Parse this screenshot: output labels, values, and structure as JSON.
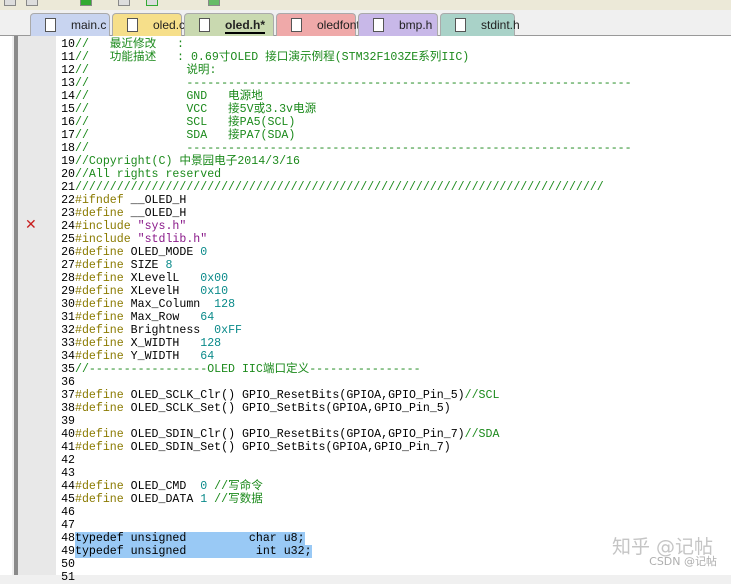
{
  "tabs": [
    {
      "label": "main.c",
      "color": "#c8d4f0",
      "active": false
    },
    {
      "label": "oled.c",
      "color": "#f6df8a",
      "active": false
    },
    {
      "label": "oled.h*",
      "color": "#c9d9b0",
      "active": true
    },
    {
      "label": "oledfont.h",
      "color": "#efa9a9",
      "active": false
    },
    {
      "label": "bmp.h",
      "color": "#c8b8e8",
      "active": false
    },
    {
      "label": "stdint.h",
      "color": "#a9d2c8",
      "active": false
    }
  ],
  "editor": {
    "error_line": 24,
    "selected_lines": [
      48,
      49
    ],
    "lines": [
      {
        "n": "10",
        "t": [
          [
            "c",
            "//   最近修改   :"
          ]
        ]
      },
      {
        "n": "11",
        "t": [
          [
            "c",
            "//   功能描述   : 0.69寸OLED 接口演示例程(STM32F103ZE系列IIC)"
          ]
        ]
      },
      {
        "n": "12",
        "t": [
          [
            "c",
            "//              说明:"
          ]
        ]
      },
      {
        "n": "13",
        "t": [
          [
            "c",
            "//              ----------------------------------------------------------------"
          ]
        ]
      },
      {
        "n": "14",
        "t": [
          [
            "c",
            "//              GND   电源地"
          ]
        ]
      },
      {
        "n": "15",
        "t": [
          [
            "c",
            "//              VCC   接5V或3.3v电源"
          ]
        ]
      },
      {
        "n": "16",
        "t": [
          [
            "c",
            "//              SCL   接PA5(SCL)"
          ]
        ]
      },
      {
        "n": "17",
        "t": [
          [
            "c",
            "//              SDA   接PA7(SDA)"
          ]
        ]
      },
      {
        "n": "18",
        "t": [
          [
            "c",
            "//              ----------------------------------------------------------------"
          ]
        ]
      },
      {
        "n": "19",
        "t": [
          [
            "c",
            "//Copyright(C) 中景园电子2014/3/16"
          ]
        ]
      },
      {
        "n": "20",
        "t": [
          [
            "c",
            "//All rights reserved"
          ]
        ]
      },
      {
        "n": "21",
        "t": [
          [
            "c",
            "////////////////////////////////////////////////////////////////////////////"
          ]
        ]
      },
      {
        "n": "22",
        "t": [
          [
            "p",
            "#ifndef "
          ],
          [
            "t",
            "__OLED_H"
          ]
        ]
      },
      {
        "n": "23",
        "t": [
          [
            "p",
            "#define "
          ],
          [
            "t",
            "__OLED_H"
          ]
        ]
      },
      {
        "n": "24",
        "t": [
          [
            "p",
            "#include "
          ],
          [
            "s",
            "\"sys.h\""
          ]
        ]
      },
      {
        "n": "25",
        "t": [
          [
            "p",
            "#include "
          ],
          [
            "s",
            "\"stdlib.h\""
          ]
        ]
      },
      {
        "n": "26",
        "t": [
          [
            "p",
            "#define "
          ],
          [
            "t",
            "OLED_MODE "
          ],
          [
            "n",
            "0"
          ]
        ]
      },
      {
        "n": "27",
        "t": [
          [
            "p",
            "#define "
          ],
          [
            "t",
            "SIZE "
          ],
          [
            "n",
            "8"
          ]
        ]
      },
      {
        "n": "28",
        "t": [
          [
            "p",
            "#define "
          ],
          [
            "t",
            "XLevelL   "
          ],
          [
            "n",
            "0x00"
          ]
        ]
      },
      {
        "n": "29",
        "t": [
          [
            "p",
            "#define "
          ],
          [
            "t",
            "XLevelH   "
          ],
          [
            "n",
            "0x10"
          ]
        ]
      },
      {
        "n": "30",
        "t": [
          [
            "p",
            "#define "
          ],
          [
            "t",
            "Max_Column  "
          ],
          [
            "n",
            "128"
          ]
        ]
      },
      {
        "n": "31",
        "t": [
          [
            "p",
            "#define "
          ],
          [
            "t",
            "Max_Row   "
          ],
          [
            "n",
            "64"
          ]
        ]
      },
      {
        "n": "32",
        "t": [
          [
            "p",
            "#define "
          ],
          [
            "t",
            "Brightness  "
          ],
          [
            "n",
            "0xFF"
          ]
        ]
      },
      {
        "n": "33",
        "t": [
          [
            "p",
            "#define "
          ],
          [
            "t",
            "X_WIDTH   "
          ],
          [
            "n",
            "128"
          ]
        ]
      },
      {
        "n": "34",
        "t": [
          [
            "p",
            "#define "
          ],
          [
            "t",
            "Y_WIDTH   "
          ],
          [
            "n",
            "64"
          ]
        ]
      },
      {
        "n": "35",
        "t": [
          [
            "c",
            "//-----------------OLED IIC端口定义----------------"
          ]
        ]
      },
      {
        "n": "36",
        "t": []
      },
      {
        "n": "37",
        "t": [
          [
            "p",
            "#define "
          ],
          [
            "t",
            "OLED_SCLK_Clr() GPIO_ResetBits(GPIOA,GPIO_Pin_5)"
          ],
          [
            "c",
            "//SCL"
          ]
        ]
      },
      {
        "n": "38",
        "t": [
          [
            "p",
            "#define "
          ],
          [
            "t",
            "OLED_SCLK_Set() GPIO_SetBits(GPIOA,GPIO_Pin_5)"
          ]
        ]
      },
      {
        "n": "39",
        "t": []
      },
      {
        "n": "40",
        "t": [
          [
            "p",
            "#define "
          ],
          [
            "t",
            "OLED_SDIN_Clr() GPIO_ResetBits(GPIOA,GPIO_Pin_7)"
          ],
          [
            "c",
            "//SDA"
          ]
        ]
      },
      {
        "n": "41",
        "t": [
          [
            "p",
            "#define "
          ],
          [
            "t",
            "OLED_SDIN_Set() GPIO_SetBits(GPIOA,GPIO_Pin_7)"
          ]
        ]
      },
      {
        "n": "42",
        "t": []
      },
      {
        "n": "43",
        "t": []
      },
      {
        "n": "44",
        "t": [
          [
            "p",
            "#define "
          ],
          [
            "t",
            "OLED_CMD  "
          ],
          [
            "n",
            "0 "
          ],
          [
            "c",
            "//写命令"
          ]
        ]
      },
      {
        "n": "45",
        "t": [
          [
            "p",
            "#define "
          ],
          [
            "t",
            "OLED_DATA "
          ],
          [
            "n",
            "1 "
          ],
          [
            "c",
            "//写数据"
          ]
        ]
      },
      {
        "n": "46",
        "t": []
      },
      {
        "n": "47",
        "t": []
      },
      {
        "n": "48",
        "t": [
          [
            "t",
            "typedef unsigned         char u8;"
          ]
        ]
      },
      {
        "n": "49",
        "t": [
          [
            "t",
            "typedef unsigned          int u32;"
          ]
        ]
      },
      {
        "n": "50",
        "t": []
      },
      {
        "n": "51",
        "t": []
      }
    ]
  },
  "watermark": {
    "main": "知乎 @记帖",
    "sub": "CSDN @记帖"
  },
  "icons": {
    "error": "✕"
  }
}
